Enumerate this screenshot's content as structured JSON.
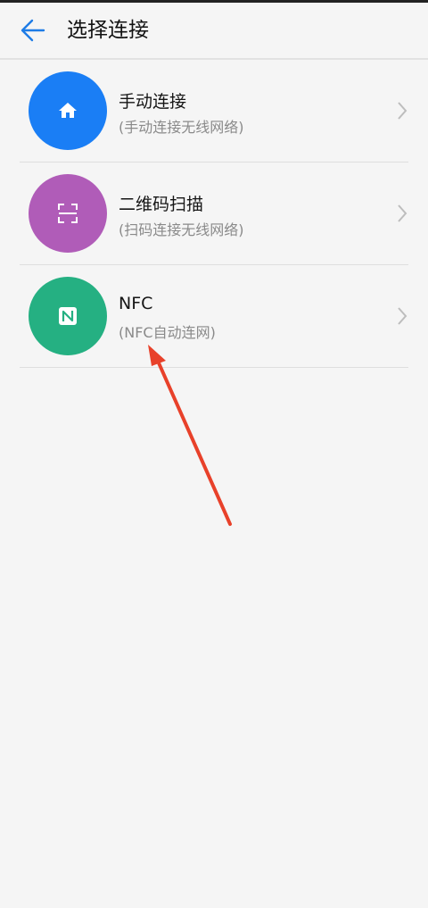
{
  "header": {
    "title": "选择连接"
  },
  "colors": {
    "manual": "#1a7ef5",
    "qr": "#b05cb8",
    "nfc": "#25b082",
    "annotation_arrow": "#e8412a"
  },
  "items": [
    {
      "label": "手动连接",
      "sub": "(手动连接无线网络)",
      "icon": "home-icon"
    },
    {
      "label": "二维码扫描",
      "sub": "(扫码连接无线网络)",
      "icon": "scan-icon"
    },
    {
      "label": "NFC",
      "sub": "(NFC自动连网)",
      "icon": "nfc-icon"
    }
  ]
}
